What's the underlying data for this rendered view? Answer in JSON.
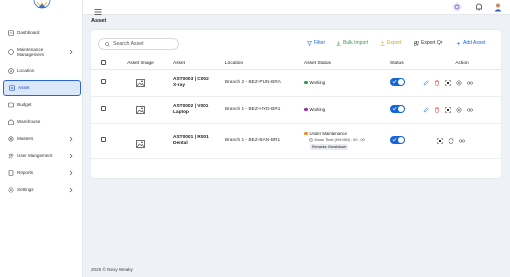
{
  "sidebar": {
    "items": [
      {
        "label": "Dashboard",
        "icon": "grid-icon",
        "chevron": false
      },
      {
        "label": "Maintenance\nManagement",
        "icon": "wrench-icon",
        "chevron": true
      },
      {
        "label": "Location",
        "icon": "location-pin-icon",
        "chevron": false
      },
      {
        "label": "Asset",
        "icon": "asset-box-icon",
        "chevron": false,
        "active": true
      },
      {
        "label": "Budget",
        "icon": "wallet-icon",
        "chevron": false
      },
      {
        "label": "Warehouse",
        "icon": "warehouse-icon",
        "chevron": false
      },
      {
        "label": "Masters",
        "icon": "gear-icon",
        "chevron": true
      },
      {
        "label": "User Mangement",
        "icon": "users-icon",
        "chevron": true
      },
      {
        "label": "Reports",
        "icon": "document-icon",
        "chevron": true
      },
      {
        "label": "Settings",
        "icon": "settings-icon",
        "chevron": true
      }
    ]
  },
  "page": {
    "title": "Asset",
    "footer": "2026 © Nexy Weaky"
  },
  "toolbar": {
    "search_placeholder": "Search Asset",
    "filter": "Filter",
    "bulk_import": "Bulk Import",
    "export": "Export",
    "export_qr": "Export Qr",
    "add_asset": "Add Asset"
  },
  "table": {
    "headers": [
      "Asset Image",
      "Asset",
      "Location",
      "Asset Status",
      "Status",
      "Action"
    ],
    "rows": [
      {
        "asset_line1": "AST0003 | C002",
        "asset_line2": "X-ray",
        "location": "Branch 2 - BEZ-PUN-BRA",
        "status": "Working",
        "status_color": "#2e9b4e",
        "enabled": true
      },
      {
        "asset_line1": "AST0002 | V001",
        "asset_line2": "Laptop",
        "location": "Branch 1 - BEZ-HYD-BR1",
        "status": "Working",
        "status_color": "#9c27b0",
        "enabled": true
      },
      {
        "asset_line1": "AST0001 | R001",
        "asset_line2": "Dental",
        "location": "Branch 1 - BEZ-BAN-BR1",
        "status": "Under Maintenance",
        "status_color": "#f08c1e",
        "down_time": "Down Time (HH:MM) : 00 : 00",
        "remarks": "Remarks: Breakdown",
        "enabled": true
      }
    ]
  },
  "colors": {
    "accent": "#1565d8",
    "active_bg": "#dbe7fb",
    "bulk_import": "#2e9b4e",
    "export": "#d4a11c",
    "delete": "#e53935"
  }
}
